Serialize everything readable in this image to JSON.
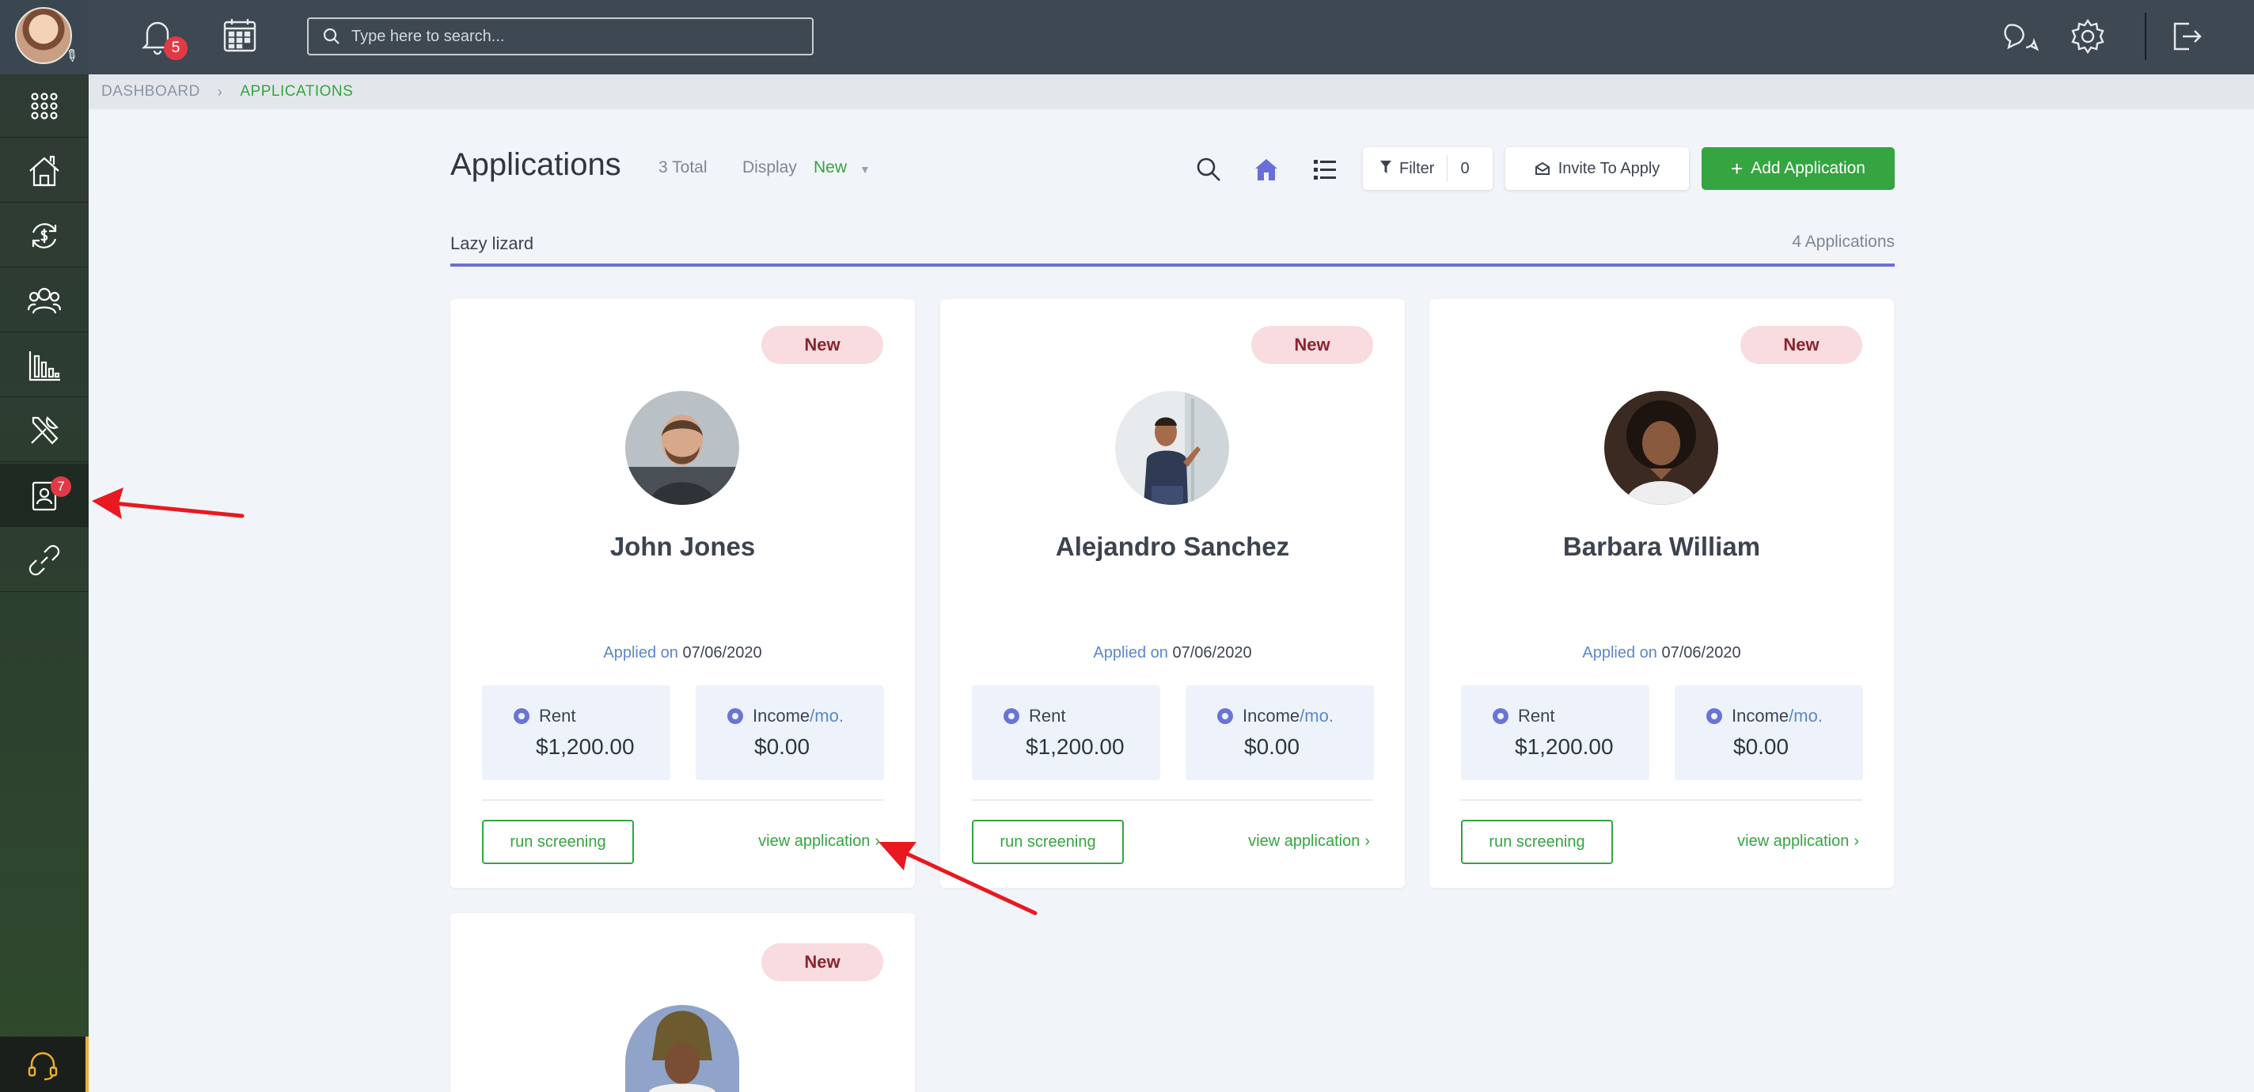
{
  "sidebar": {
    "items": [
      {
        "name": "apps-grid-icon"
      },
      {
        "name": "properties-icon"
      },
      {
        "name": "accounting-icon"
      },
      {
        "name": "people-icon"
      },
      {
        "name": "reports-icon"
      },
      {
        "name": "maintenance-icon"
      },
      {
        "name": "applications-icon",
        "badge": "7"
      },
      {
        "name": "links-icon"
      }
    ]
  },
  "topbar": {
    "notifications_count": "5",
    "search_placeholder": "Type here to search..."
  },
  "breadcrumb": {
    "dashboard": "DASHBOARD",
    "separator": "›",
    "current": "APPLICATIONS"
  },
  "header": {
    "title": "Applications",
    "total": "3 Total",
    "display_label": "Display",
    "display_value": "New",
    "filter_label": "Filter",
    "filter_count": "0",
    "invite_label": "Invite To Apply",
    "add_label": "Add Application",
    "add_plus": "+"
  },
  "group": {
    "name": "Lazy lizard",
    "count": "4 Applications"
  },
  "labels": {
    "applied_on": "Applied on",
    "rent": "Rent",
    "income": "Income",
    "per_month": "/mo.",
    "run_screening": "run screening",
    "view_application": "view application",
    "view_chevron": "›"
  },
  "cards": [
    {
      "status": "New",
      "name": "John Jones",
      "applied_date": "07/06/2020",
      "rent": "$1,200.00",
      "income": "$0.00"
    },
    {
      "status": "New",
      "name": "Alejandro Sanchez",
      "applied_date": "07/06/2020",
      "rent": "$1,200.00",
      "income": "$0.00"
    },
    {
      "status": "New",
      "name": "Barbara William",
      "applied_date": "07/06/2020",
      "rent": "$1,200.00",
      "income": "$0.00"
    },
    {
      "status": "New"
    }
  ],
  "colors": {
    "accent_green": "#34a540",
    "topbar": "#3d4853",
    "badge_red": "#e23a45",
    "status_pill": "#f8dcdf",
    "group_line": "#6d6fd8",
    "annotation_arrow": "#e8191f"
  }
}
